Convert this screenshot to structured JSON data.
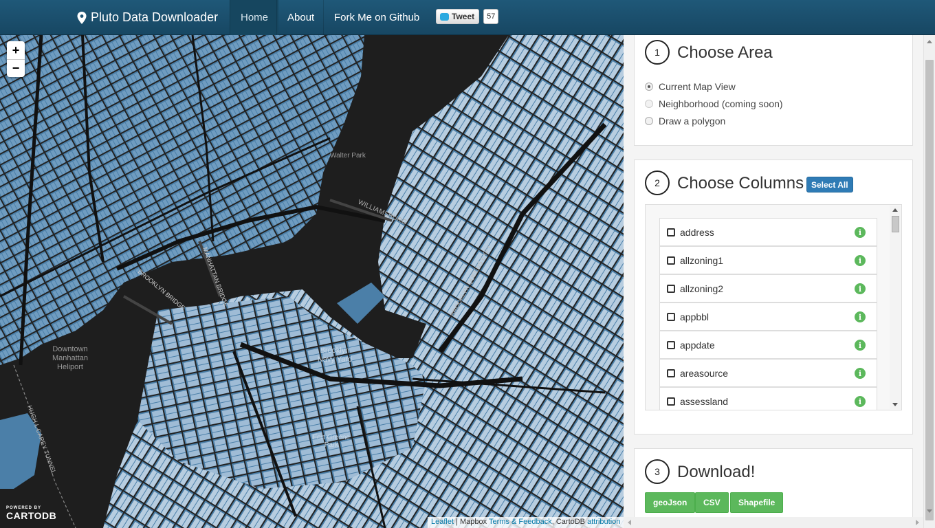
{
  "colors": {
    "navbar": "#1f5878",
    "water": "#1e1e1e",
    "lots": "#4b7fa8",
    "accent": "#2f7bb5",
    "success": "#5cb85c"
  },
  "navbar": {
    "brand_icon": "map-marker-icon",
    "brand": "Pluto Data Downloader",
    "items": [
      {
        "label": "Home",
        "active": true
      },
      {
        "label": "About",
        "active": false
      },
      {
        "label": "Fork Me on Github",
        "active": false
      }
    ],
    "tweet_label": "Tweet",
    "tweet_count": "57"
  },
  "map": {
    "zoom_in": "+",
    "zoom_out": "−",
    "labels": [
      "Walter Park",
      "WILLIAMSBURG",
      "BROOKLYN BRIDGE",
      "MANHATTAN BRIDGE",
      "Downtown Manhattan Heliport",
      "Brooklyn Navy Yard",
      "Fort Greene Park",
      "HUGH L CAREY TUNNEL",
      "BROOKLYN QUEENS EXPY"
    ],
    "carto_small": "POWERED BY",
    "carto_big": "CARTODB",
    "attribution": {
      "leaflet": "Leaflet",
      "mapbox": "Mapbox",
      "terms": "Terms & Feedback",
      "cartodb": "CartoDB",
      "attr": "attribution"
    }
  },
  "step1": {
    "number": "1",
    "title": "Choose Area",
    "options": [
      {
        "label": "Current Map View",
        "checked": true,
        "disabled": false
      },
      {
        "label": "Neighborhood (coming soon)",
        "checked": false,
        "disabled": true
      },
      {
        "label": "Draw a polygon",
        "checked": false,
        "disabled": false
      }
    ]
  },
  "step2": {
    "number": "2",
    "title": "Choose Columns",
    "select_all": "Select All",
    "columns": [
      "address",
      "allzoning1",
      "allzoning2",
      "appbbl",
      "appdate",
      "areasource",
      "assessland"
    ],
    "info_icon": "info-icon"
  },
  "step3": {
    "number": "3",
    "title": "Download!",
    "buttons": [
      "geoJson",
      "CSV",
      "Shapefile"
    ]
  }
}
